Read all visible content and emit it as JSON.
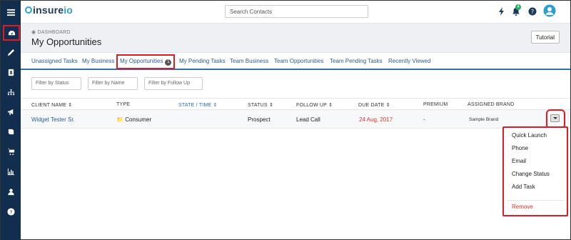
{
  "app": {
    "logo_main": "insure",
    "logo_accent": "io"
  },
  "search": {
    "placeholder": "Search Contacts"
  },
  "notifications": {
    "count": "4"
  },
  "breadcrumb": "DASHBOARD",
  "page_title": "My Opportunities",
  "tutorial_label": "Tutorial",
  "tabs": [
    {
      "label": "Unassigned Tasks"
    },
    {
      "label": "My Business"
    },
    {
      "label": "My Opportunities",
      "count": "1"
    },
    {
      "label": "My Pending Tasks"
    },
    {
      "label": "Team Business"
    },
    {
      "label": "Team Opportunities"
    },
    {
      "label": "Team Pending Tasks"
    },
    {
      "label": "Recently Viewed"
    }
  ],
  "filters": {
    "status": "Filter by Status",
    "name": "Filter by Name",
    "follow_up": "Filter by Follow Up"
  },
  "table": {
    "headers": [
      "CLIENT NAME",
      "TYPE",
      "STATE / TIME",
      "STATUS",
      "FOLLOW UP",
      "DUE DATE",
      "PREMIUM",
      "ASSIGNED BRAND"
    ],
    "rows": [
      {
        "client_name": "Widget Tester Sr.",
        "type": "Consumer",
        "state_time": "",
        "status": "Prospect",
        "follow_up": "Lead Call",
        "due_date": "24 Aug, 2017",
        "premium": "-",
        "assigned_brand": "Sample Brand"
      }
    ]
  },
  "dropdown": {
    "items": [
      "Quick Launch",
      "Phone",
      "Email",
      "Change Status",
      "Add Task"
    ],
    "remove": "Remove"
  },
  "colors": {
    "sidebar": "#112e4e",
    "link": "#2b5d93",
    "danger": "#d9362b",
    "highlight": "#e01b24"
  }
}
